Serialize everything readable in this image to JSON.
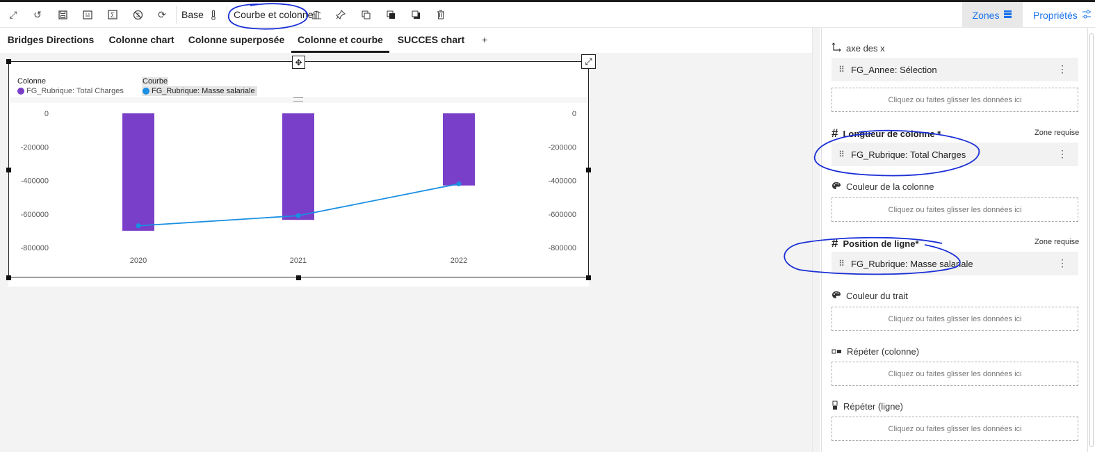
{
  "toolbar": {
    "mode_label": "Base",
    "chart_type": "Courbe et colonne",
    "zones_label": "Zones",
    "properties_label": "Propriétés"
  },
  "tabs": [
    {
      "label": "Bridges Directions"
    },
    {
      "label": "Colonne chart"
    },
    {
      "label": "Colonne superposée"
    },
    {
      "label": "Colonne et courbe"
    },
    {
      "label": "SUCCES chart"
    }
  ],
  "tab_add": "+",
  "chart_data": {
    "type": "bar",
    "categories": [
      "2020",
      "2021",
      "2022"
    ],
    "series": [
      {
        "name": "FG_Rubrique: Total Charges",
        "kind": "column",
        "color": "#7a3fc8",
        "values": [
          -700000,
          -635000,
          -430000
        ]
      },
      {
        "name": "FG_Rubrique: Masse salariale",
        "kind": "line",
        "color": "#1a8fe3",
        "values": [
          -670000,
          -610000,
          -420000
        ]
      }
    ],
    "legend": {
      "column_title": "Colonne",
      "line_title": "Courbe"
    },
    "y_ticks": [
      "0",
      "-200000",
      "-400000",
      "-600000",
      "-800000"
    ],
    "ylim": [
      -800000,
      0
    ],
    "grid": false,
    "title": ""
  },
  "panel": {
    "x_axis": {
      "label": "axe des x",
      "field": "FG_Annee: Sélection"
    },
    "column_length": {
      "label": "Longueur de colonne *",
      "required": "Zone requise",
      "field": "FG_Rubrique: Total Charges"
    },
    "column_color": {
      "label": "Couleur de la colonne"
    },
    "line_position": {
      "label": "Position de ligne*",
      "required": "Zone requise",
      "field": "FG_Rubrique: Masse salariale"
    },
    "line_color": {
      "label": "Couleur du trait"
    },
    "repeat_column": {
      "label": "Répéter (colonne)"
    },
    "repeat_line": {
      "label": "Répéter (ligne)"
    },
    "drop_hint": "Cliquez ou faites glisser les données ici"
  },
  "colors": {
    "accent": "#1a73e8",
    "annotation": "#1a2fd6"
  }
}
